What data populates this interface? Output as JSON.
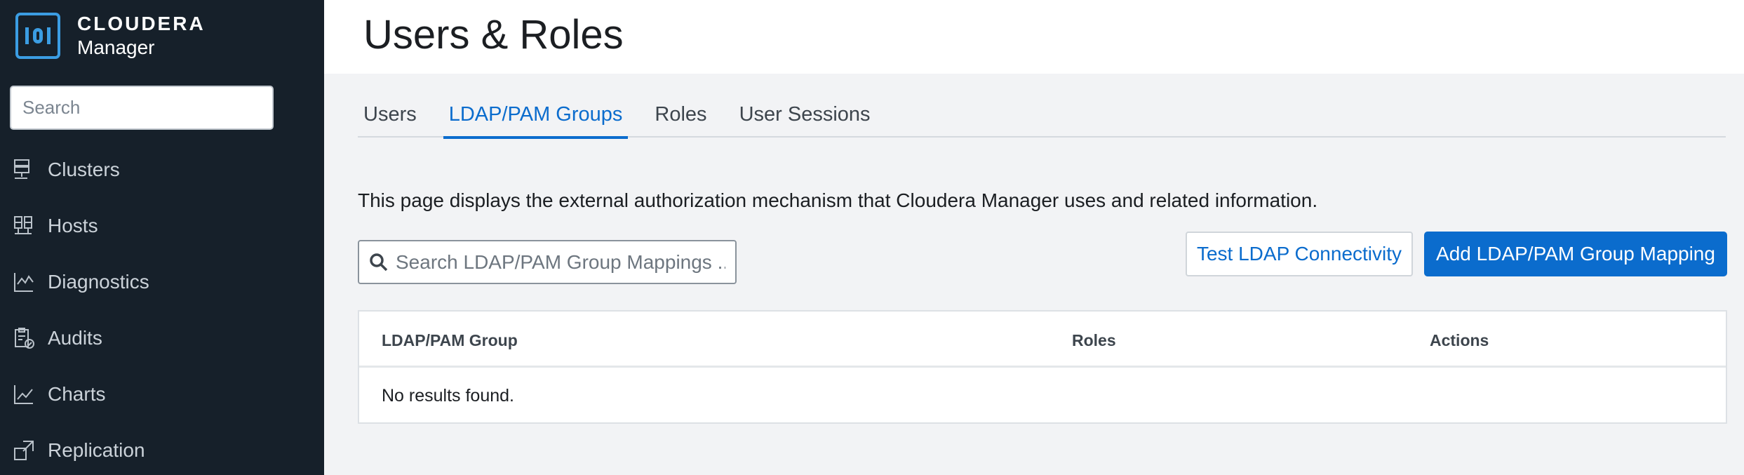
{
  "brand": {
    "company": "CLOUDERA",
    "product": "Manager"
  },
  "sidebar": {
    "search_placeholder": "Search",
    "items": [
      {
        "label": "Clusters",
        "icon": "clusters-icon"
      },
      {
        "label": "Hosts",
        "icon": "hosts-icon"
      },
      {
        "label": "Diagnostics",
        "icon": "diagnostics-icon"
      },
      {
        "label": "Audits",
        "icon": "audits-icon"
      },
      {
        "label": "Charts",
        "icon": "charts-icon"
      },
      {
        "label": "Replication",
        "icon": "replication-icon"
      }
    ]
  },
  "page": {
    "title": "Users & Roles"
  },
  "tabs": [
    {
      "label": "Users",
      "active": false
    },
    {
      "label": "LDAP/PAM Groups",
      "active": true
    },
    {
      "label": "Roles",
      "active": false
    },
    {
      "label": "User Sessions",
      "active": false
    }
  ],
  "content": {
    "description": "This page displays the external authorization mechanism that Cloudera Manager uses and related information.",
    "search_placeholder": "Search LDAP/PAM Group Mappings ...",
    "test_button": "Test LDAP Connectivity",
    "add_button": "Add LDAP/PAM Group Mapping"
  },
  "table": {
    "columns": [
      "LDAP/PAM Group",
      "Roles",
      "Actions"
    ],
    "empty_message": "No results found."
  },
  "colors": {
    "sidebar_bg": "#16202a",
    "accent": "#0b6ccd",
    "logo": "#3b9de3"
  }
}
